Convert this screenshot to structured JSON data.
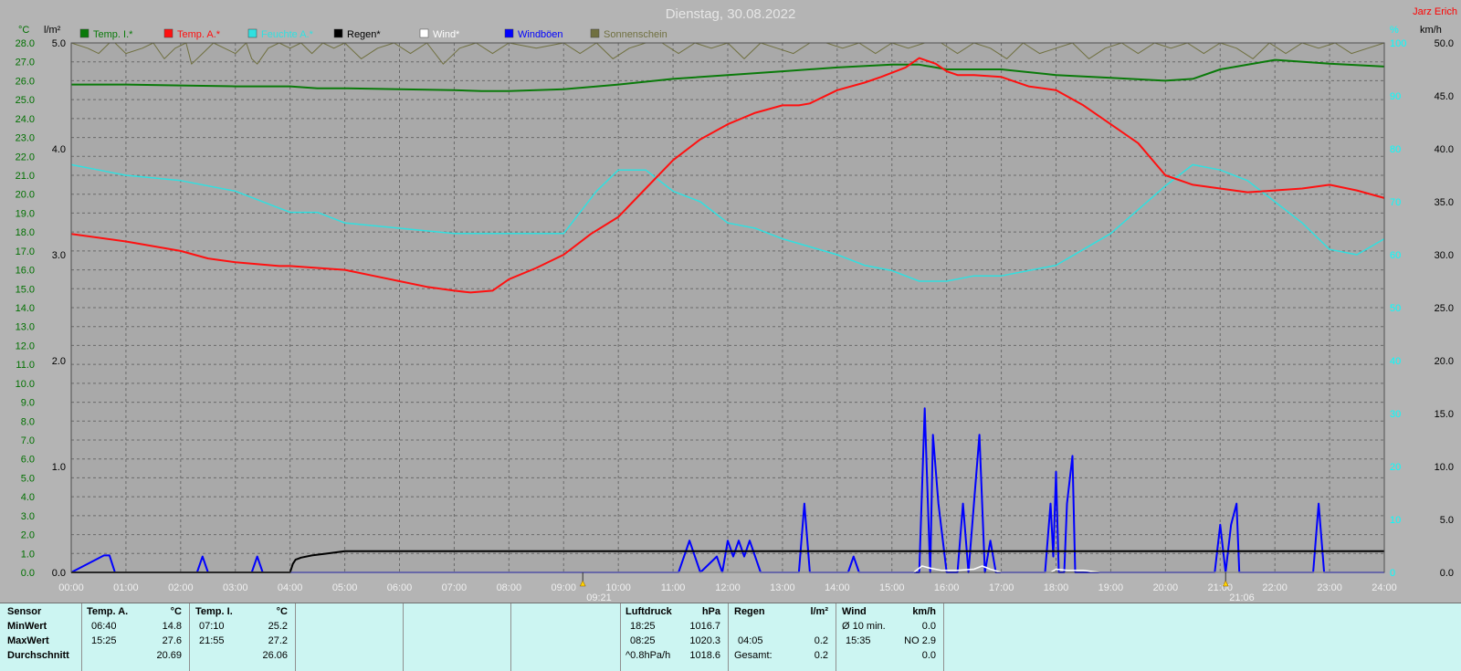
{
  "title": "Dienstag, 30.08.2022",
  "author": "Jarz Erich",
  "units": {
    "left_temp": "°C",
    "left_rain": "l/m²",
    "right_pct": "%",
    "right_wind": "km/h"
  },
  "colors": {
    "temp_inside": "#0a7a0a",
    "temp_outside": "#ff1010",
    "humidity": "#30e0e0",
    "rain": "#000000",
    "wind": "#ffffff",
    "gusts": "#0000ff",
    "sunshine": "#707040",
    "temp_axis": "#007000",
    "humidity_axis": "#00ffff"
  },
  "legend": [
    {
      "label": "Temp. I.*",
      "color": "#0a7a0a"
    },
    {
      "label": "Temp. A.*",
      "color": "#ff1010"
    },
    {
      "label": "Feuchte A.*",
      "color": "#30e0e0"
    },
    {
      "label": "Regen*",
      "color": "#000000"
    },
    {
      "label": "Wind*",
      "color": "#ffffff"
    },
    {
      "label": "Windböen",
      "color": "#0000ff"
    },
    {
      "label": "Sonnenschein",
      "color": "#707040"
    }
  ],
  "markers": [
    {
      "label": "09:21",
      "hour": 9.35
    },
    {
      "label": "21:06",
      "hour": 21.1
    }
  ],
  "chart_data": {
    "type": "line",
    "title": "Dienstag, 30.08.2022",
    "x_range": [
      0,
      24
    ],
    "x_ticks": [
      "00:00",
      "01:00",
      "02:00",
      "03:00",
      "04:00",
      "05:00",
      "06:00",
      "07:00",
      "08:00",
      "09:00",
      "10:00",
      "11:00",
      "12:00",
      "13:00",
      "14:00",
      "15:00",
      "16:00",
      "17:00",
      "18:00",
      "19:00",
      "20:00",
      "21:00",
      "22:00",
      "23:00",
      "24:00"
    ],
    "axes": {
      "temp": {
        "unit": "°C",
        "range": [
          0,
          28
        ],
        "ticks": [
          "0.0",
          "1.0",
          "2.0",
          "3.0",
          "4.0",
          "5.0",
          "6.0",
          "7.0",
          "8.0",
          "9.0",
          "10.0",
          "11.0",
          "12.0",
          "13.0",
          "14.0",
          "15.0",
          "16.0",
          "17.0",
          "18.0",
          "19.0",
          "20.0",
          "21.0",
          "22.0",
          "23.0",
          "24.0",
          "25.0",
          "26.0",
          "27.0",
          "28.0"
        ]
      },
      "rain": {
        "unit": "l/m²",
        "range": [
          0,
          5
        ],
        "ticks": [
          "0.0",
          "1.0",
          "2.0",
          "3.0",
          "4.0",
          "5.0"
        ]
      },
      "humidity": {
        "unit": "%",
        "range": [
          0,
          100
        ],
        "ticks": [
          "0",
          "10",
          "20",
          "30",
          "40",
          "50",
          "60",
          "70",
          "80",
          "90",
          "100"
        ]
      },
      "wind": {
        "unit": "km/h",
        "range": [
          0,
          50
        ],
        "ticks": [
          "0.0",
          "5.0",
          "10.0",
          "15.0",
          "20.0",
          "25.0",
          "30.0",
          "35.0",
          "40.0",
          "45.0",
          "50.0"
        ]
      }
    },
    "grid": true,
    "series": [
      {
        "name": "Temp. I.*",
        "axis": "temp",
        "x": [
          0,
          1,
          2,
          3,
          4,
          4.5,
          5,
          6,
          7,
          7.5,
          8,
          9,
          10,
          11,
          12,
          13,
          14,
          15,
          15.5,
          16,
          17,
          18,
          19,
          20,
          20.5,
          21,
          22,
          23,
          24
        ],
        "y": [
          25.8,
          25.8,
          25.75,
          25.7,
          25.7,
          25.6,
          25.6,
          25.55,
          25.5,
          25.45,
          25.45,
          25.55,
          25.8,
          26.1,
          26.3,
          26.5,
          26.7,
          26.85,
          26.85,
          26.6,
          26.6,
          26.3,
          26.15,
          26.0,
          26.1,
          26.6,
          27.1,
          26.9,
          26.75
        ]
      },
      {
        "name": "Temp. A.*",
        "axis": "temp",
        "x": [
          0,
          1,
          2,
          2.5,
          3,
          3.8,
          4,
          4.5,
          5,
          5.5,
          6,
          6.5,
          7,
          7.3,
          7.7,
          8,
          8.5,
          9,
          9.5,
          10,
          10.5,
          11,
          11.5,
          12,
          12.5,
          13,
          13.3,
          13.5,
          14,
          14.5,
          14.8,
          15.25,
          15.5,
          15.8,
          16,
          16.2,
          16.5,
          17,
          17.5,
          18,
          18.5,
          19,
          19.5,
          20,
          20.5,
          21,
          21.5,
          22,
          22.5,
          23,
          23.5,
          24
        ],
        "y": [
          17.9,
          17.5,
          17.0,
          16.6,
          16.4,
          16.2,
          16.2,
          16.1,
          16.0,
          15.7,
          15.4,
          15.1,
          14.9,
          14.8,
          14.9,
          15.5,
          16.1,
          16.8,
          17.9,
          18.8,
          20.3,
          21.8,
          22.9,
          23.7,
          24.3,
          24.7,
          24.7,
          24.8,
          25.5,
          25.9,
          26.2,
          26.7,
          27.2,
          26.9,
          26.5,
          26.3,
          26.3,
          26.2,
          25.7,
          25.5,
          24.7,
          23.7,
          22.7,
          21.0,
          20.5,
          20.3,
          20.1,
          20.2,
          20.3,
          20.5,
          20.2,
          19.8
        ]
      },
      {
        "name": "Feuchte A.*",
        "axis": "humidity",
        "x": [
          0,
          0.5,
          1,
          2,
          3,
          4,
          4.5,
          5,
          6,
          7,
          8,
          9,
          9.6,
          10,
          10.5,
          11,
          11.5,
          12,
          12.5,
          13,
          14,
          14.5,
          15,
          15.5,
          16,
          16.5,
          17,
          17.5,
          18,
          18.5,
          19,
          20,
          20.5,
          21,
          21.5,
          22,
          22.5,
          23,
          23.5,
          24
        ],
        "y": [
          77,
          76,
          75,
          74,
          72,
          68,
          68,
          66,
          65,
          64,
          64,
          64,
          72,
          76,
          76,
          72,
          70,
          66,
          65,
          63,
          60,
          58,
          57,
          55,
          55,
          56,
          56,
          57,
          58,
          61,
          64,
          73,
          77,
          76,
          74,
          70,
          66,
          61,
          60,
          63
        ]
      },
      {
        "name": "Regen*",
        "axis": "rain",
        "x": [
          0,
          4.0,
          4.05,
          4.1,
          4.2,
          4.4,
          4.7,
          5.0,
          6,
          8,
          10,
          12,
          14,
          16,
          18,
          20,
          22,
          24
        ],
        "y": [
          0,
          0,
          0.08,
          0.12,
          0.14,
          0.16,
          0.18,
          0.2,
          0.2,
          0.2,
          0.2,
          0.2,
          0.2,
          0.2,
          0.2,
          0.2,
          0.2,
          0.2
        ]
      },
      {
        "name": "Wind*",
        "axis": "wind",
        "x": [
          0,
          15.4,
          15.55,
          15.7,
          15.9,
          16.2,
          16.5,
          16.65,
          16.8,
          17.0,
          17.9,
          18.0,
          18.2,
          18.5,
          18.8,
          19,
          24
        ],
        "y": [
          0,
          0,
          0.6,
          0.4,
          0.2,
          0.2,
          0.3,
          0.6,
          0.3,
          0,
          0,
          0.3,
          0.2,
          0.2,
          0,
          0,
          0
        ]
      },
      {
        "name": "Windböen",
        "axis": "wind",
        "x": [
          0,
          0.6,
          0.7,
          0.8,
          0.9,
          2.3,
          2.4,
          2.5,
          3.3,
          3.4,
          3.5,
          11.1,
          11.3,
          11.5,
          11.8,
          11.9,
          12.0,
          12.1,
          12.2,
          12.3,
          12.4,
          12.5,
          12.6,
          13.3,
          13.4,
          13.5,
          14.2,
          14.3,
          14.4,
          15.5,
          15.6,
          15.7,
          15.75,
          15.85,
          16.0,
          16.2,
          16.3,
          16.4,
          16.5,
          16.6,
          16.7,
          16.8,
          16.9,
          17.0,
          17.8,
          17.9,
          17.95,
          18.0,
          18.05,
          18.15,
          18.2,
          18.3,
          18.35,
          18.45,
          20.9,
          21.0,
          21.1,
          21.2,
          21.3,
          21.35,
          22.7,
          22.8,
          22.9,
          24
        ],
        "y": [
          0,
          1.6,
          1.6,
          0,
          0,
          0,
          1.5,
          0,
          0,
          1.5,
          0,
          0,
          3.0,
          0,
          1.5,
          0,
          3.0,
          1.5,
          3.0,
          1.5,
          3.0,
          1.5,
          0,
          0,
          6.5,
          0,
          0,
          1.5,
          0,
          0,
          15.5,
          0,
          13.0,
          6.5,
          0,
          0,
          6.5,
          0,
          6.5,
          13.0,
          0,
          3.0,
          0,
          0,
          0,
          6.5,
          1.5,
          9.5,
          0,
          0,
          6.5,
          11.0,
          0,
          0,
          0,
          4.5,
          0,
          4.5,
          6.5,
          0,
          0,
          6.5,
          0,
          0
        ]
      },
      {
        "name": "Sonnenschein",
        "axis": "humidity",
        "x": [
          0,
          0.3,
          0.5,
          0.7,
          0.8,
          1,
          1.3,
          1.5,
          1.7,
          1.9,
          2.1,
          2.2,
          2.4,
          2.6,
          2.8,
          3,
          3.2,
          3.3,
          3.4,
          3.6,
          3.8,
          4,
          4.2,
          4.4,
          4.6,
          4.8,
          5,
          5.3,
          5.6,
          5.9,
          6.2,
          6.5,
          6.8,
          7.1,
          7.4,
          7.7,
          8,
          8.5,
          9,
          9.3,
          9.6,
          9.9,
          10.2,
          10.5,
          10.8,
          11.1,
          11.4,
          11.7,
          12,
          12.3,
          12.6,
          12.9,
          13.2,
          13.5,
          13.8,
          14.1,
          14.4,
          14.7,
          15,
          15.3,
          15.6,
          15.9,
          16.2,
          16.5,
          16.8,
          17.1,
          17.4,
          17.7,
          18,
          18.3,
          18.6,
          18.9,
          19.2,
          19.5,
          19.8,
          20.1,
          20.4,
          20.7,
          21,
          21.3,
          21.6,
          21.9,
          22.2,
          22.5,
          22.8,
          23.1,
          23.4,
          23.7,
          24
        ],
        "y": [
          100,
          99,
          98,
          100,
          100,
          98,
          99,
          100,
          97,
          99,
          100,
          96,
          98,
          100,
          99,
          98,
          100,
          97,
          96,
          99,
          100,
          99,
          100,
          98,
          100,
          99,
          100,
          97,
          99,
          100,
          98,
          100,
          96,
          99,
          100,
          98,
          100,
          99,
          100,
          98,
          100,
          97,
          99,
          100,
          100,
          98,
          100,
          99,
          100,
          97,
          100,
          99,
          98,
          100,
          100,
          99,
          100,
          98,
          100,
          99,
          100,
          100,
          98,
          100,
          99,
          97,
          100,
          98,
          99,
          100,
          97,
          99,
          100,
          98,
          100,
          99,
          100,
          98,
          100,
          99,
          97,
          100,
          98,
          100,
          99,
          100,
          98,
          99,
          100
        ]
      }
    ]
  },
  "stats": {
    "sensor_header": "Sensor",
    "row_labels": [
      "MinWert",
      "MaxWert",
      "Durchschnitt"
    ],
    "temp_a": {
      "header": "Temp. A.",
      "unit": "°C",
      "min_time": "06:40",
      "min": "14.8",
      "max_time": "15:25",
      "max": "27.6",
      "avg": "20.69"
    },
    "temp_i": {
      "header": "Temp. I.",
      "unit": "°C",
      "min_time": "07:10",
      "min": "25.2",
      "max_time": "21:55",
      "max": "27.2",
      "avg": "26.06"
    },
    "pressure": {
      "header": "Luftdruck",
      "unit": "hPa",
      "min_time": "18:25",
      "min": "1016.7",
      "max_time": "08:25",
      "max": "1020.3",
      "avg_label": "^0.8hPa/h",
      "avg": "1018.6"
    },
    "rain": {
      "header": "Regen",
      "unit": "l/m²",
      "row1_time": "",
      "row1": "",
      "row2_time": "04:05",
      "row2": "0.2",
      "row3_label": "Gesamt:",
      "row3": "0.2"
    },
    "wind": {
      "header": "Wind",
      "unit": "km/h",
      "row1_label": "Ø 10 min.",
      "row1": "0.0",
      "row2_time": "15:35",
      "row2": "NO 2.9",
      "row3": "0.0"
    }
  }
}
